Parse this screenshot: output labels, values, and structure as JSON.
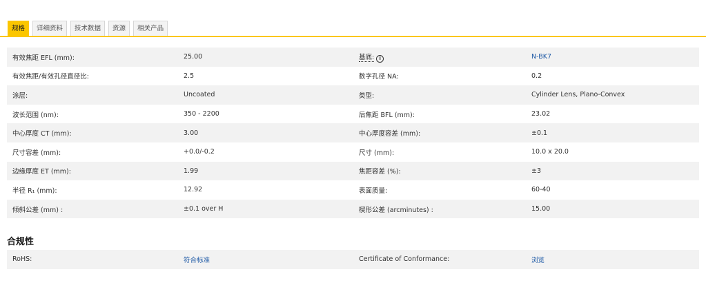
{
  "tabs": [
    {
      "label": "规格",
      "active": true
    },
    {
      "label": "详细资料",
      "active": false
    },
    {
      "label": "技术数据",
      "active": false
    },
    {
      "label": "资源",
      "active": false
    },
    {
      "label": "相关产品",
      "active": false
    }
  ],
  "specs": [
    {
      "label1": "有效焦距 EFL (mm):",
      "value1": "25.00",
      "label2": "基底:",
      "value2": "N-BK7"
    },
    {
      "label1": "有效焦距/有效孔径直径比:",
      "value1": "2.5",
      "label2": "数字孔径 NA:",
      "value2": "0.2"
    },
    {
      "label1": "涂层:",
      "value1": "Uncoated",
      "label2": "类型:",
      "value2": "Cylinder Lens, Plano-Convex"
    },
    {
      "label1": "波长范围 (nm):",
      "value1": "350 - 2200",
      "label2": "后焦距 BFL (mm):",
      "value2": "23.02"
    },
    {
      "label1": "中心厚度 CT (mm):",
      "value1": "3.00",
      "label2": "中心厚度容差 (mm):",
      "value2": "±0.1"
    },
    {
      "label1": "尺寸容差 (mm):",
      "value1": "+0.0/-0.2",
      "label2": "尺寸 (mm):",
      "value2": "10.0 x 20.0"
    },
    {
      "label1": "边缘厚度 ET (mm):",
      "value1": "1.99",
      "label2": "焦距容差 (%):",
      "value2": "±3"
    },
    {
      "label1": "半径 R₁ (mm):",
      "value1": "12.92",
      "label2": "表面质量:",
      "value2": "60-40"
    },
    {
      "label1": "倾斜公差 (mm) :",
      "value1": "±0.1 over H",
      "label2": "楔形公差 (arcminutes) :",
      "value2": "15.00"
    }
  ],
  "substrate_info_icon": "i",
  "compliance": {
    "title": "合规性",
    "rows": [
      {
        "label1": "RoHS:",
        "value1": "符合标准",
        "label2": "Certificate of Conformance:",
        "value2": "浏览"
      }
    ]
  },
  "colors": {
    "accent": "#fbc600",
    "link": "#1f5aa6",
    "stripe": "#f2f2f2"
  }
}
